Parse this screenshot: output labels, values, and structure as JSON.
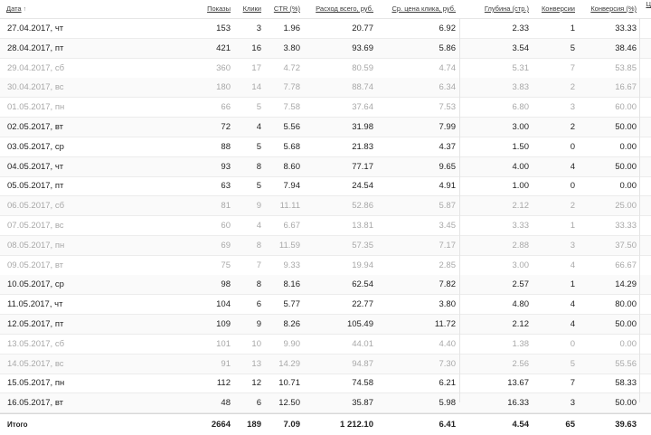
{
  "columns": {
    "date": "Дата",
    "date_sort_icon": "arrow-up",
    "impressions": "Показы",
    "clicks": "Клики",
    "ctr": "CTR (%)",
    "spend": "Расход всего, руб.",
    "cpc": "Ср. цена клика, руб.",
    "depth": "Глубина (стр.)",
    "conversions": "Конверсии",
    "conv_rate": "Конверсия (%)",
    "cut": "Ц"
  },
  "rows": [
    {
      "date": "27.04.2017, чт",
      "impressions": "153",
      "clicks": "3",
      "ctr": "1.96",
      "spend": "20.77",
      "cpc": "6.92",
      "depth": "2.33",
      "conversions": "1",
      "conv_rate": "33.33",
      "muted": false
    },
    {
      "date": "28.04.2017, пт",
      "impressions": "421",
      "clicks": "16",
      "ctr": "3.80",
      "spend": "93.69",
      "cpc": "5.86",
      "depth": "3.54",
      "conversions": "5",
      "conv_rate": "38.46",
      "muted": false
    },
    {
      "date": "29.04.2017, сб",
      "impressions": "360",
      "clicks": "17",
      "ctr": "4.72",
      "spend": "80.59",
      "cpc": "4.74",
      "depth": "5.31",
      "conversions": "7",
      "conv_rate": "53.85",
      "muted": true
    },
    {
      "date": "30.04.2017, вс",
      "impressions": "180",
      "clicks": "14",
      "ctr": "7.78",
      "spend": "88.74",
      "cpc": "6.34",
      "depth": "3.83",
      "conversions": "2",
      "conv_rate": "16.67",
      "muted": true
    },
    {
      "date": "01.05.2017, пн",
      "impressions": "66",
      "clicks": "5",
      "ctr": "7.58",
      "spend": "37.64",
      "cpc": "7.53",
      "depth": "6.80",
      "conversions": "3",
      "conv_rate": "60.00",
      "muted": true
    },
    {
      "date": "02.05.2017, вт",
      "impressions": "72",
      "clicks": "4",
      "ctr": "5.56",
      "spend": "31.98",
      "cpc": "7.99",
      "depth": "3.00",
      "conversions": "2",
      "conv_rate": "50.00",
      "muted": false
    },
    {
      "date": "03.05.2017, ср",
      "impressions": "88",
      "clicks": "5",
      "ctr": "5.68",
      "spend": "21.83",
      "cpc": "4.37",
      "depth": "1.50",
      "conversions": "0",
      "conv_rate": "0.00",
      "muted": false
    },
    {
      "date": "04.05.2017, чт",
      "impressions": "93",
      "clicks": "8",
      "ctr": "8.60",
      "spend": "77.17",
      "cpc": "9.65",
      "depth": "4.00",
      "conversions": "4",
      "conv_rate": "50.00",
      "muted": false
    },
    {
      "date": "05.05.2017, пт",
      "impressions": "63",
      "clicks": "5",
      "ctr": "7.94",
      "spend": "24.54",
      "cpc": "4.91",
      "depth": "1.00",
      "conversions": "0",
      "conv_rate": "0.00",
      "muted": false
    },
    {
      "date": "06.05.2017, сб",
      "impressions": "81",
      "clicks": "9",
      "ctr": "11.11",
      "spend": "52.86",
      "cpc": "5.87",
      "depth": "2.12",
      "conversions": "2",
      "conv_rate": "25.00",
      "muted": true
    },
    {
      "date": "07.05.2017, вс",
      "impressions": "60",
      "clicks": "4",
      "ctr": "6.67",
      "spend": "13.81",
      "cpc": "3.45",
      "depth": "3.33",
      "conversions": "1",
      "conv_rate": "33.33",
      "muted": true
    },
    {
      "date": "08.05.2017, пн",
      "impressions": "69",
      "clicks": "8",
      "ctr": "11.59",
      "spend": "57.35",
      "cpc": "7.17",
      "depth": "2.88",
      "conversions": "3",
      "conv_rate": "37.50",
      "muted": true
    },
    {
      "date": "09.05.2017, вт",
      "impressions": "75",
      "clicks": "7",
      "ctr": "9.33",
      "spend": "19.94",
      "cpc": "2.85",
      "depth": "3.00",
      "conversions": "4",
      "conv_rate": "66.67",
      "muted": true
    },
    {
      "date": "10.05.2017, ср",
      "impressions": "98",
      "clicks": "8",
      "ctr": "8.16",
      "spend": "62.54",
      "cpc": "7.82",
      "depth": "2.57",
      "conversions": "1",
      "conv_rate": "14.29",
      "muted": false
    },
    {
      "date": "11.05.2017, чт",
      "impressions": "104",
      "clicks": "6",
      "ctr": "5.77",
      "spend": "22.77",
      "cpc": "3.80",
      "depth": "4.80",
      "conversions": "4",
      "conv_rate": "80.00",
      "muted": false
    },
    {
      "date": "12.05.2017, пт",
      "impressions": "109",
      "clicks": "9",
      "ctr": "8.26",
      "spend": "105.49",
      "cpc": "11.72",
      "depth": "2.12",
      "conversions": "4",
      "conv_rate": "50.00",
      "muted": false
    },
    {
      "date": "13.05.2017, сб",
      "impressions": "101",
      "clicks": "10",
      "ctr": "9.90",
      "spend": "44.01",
      "cpc": "4.40",
      "depth": "1.38",
      "conversions": "0",
      "conv_rate": "0.00",
      "muted": true
    },
    {
      "date": "14.05.2017, вс",
      "impressions": "91",
      "clicks": "13",
      "ctr": "14.29",
      "spend": "94.87",
      "cpc": "7.30",
      "depth": "2.56",
      "conversions": "5",
      "conv_rate": "55.56",
      "muted": true
    },
    {
      "date": "15.05.2017, пн",
      "impressions": "112",
      "clicks": "12",
      "ctr": "10.71",
      "spend": "74.58",
      "cpc": "6.21",
      "depth": "13.67",
      "conversions": "7",
      "conv_rate": "58.33",
      "muted": false
    },
    {
      "date": "16.05.2017, вт",
      "impressions": "48",
      "clicks": "6",
      "ctr": "12.50",
      "spend": "35.87",
      "cpc": "5.98",
      "depth": "16.33",
      "conversions": "3",
      "conv_rate": "50.00",
      "muted": false
    }
  ],
  "totals": {
    "label": "Итого",
    "impressions": "2664",
    "clicks": "189",
    "ctr": "7.09",
    "spend": "1 212.10",
    "cpc": "6.41",
    "depth": "4.54",
    "conversions": "65",
    "conv_rate": "39.63"
  },
  "colors": {
    "muted_text": "#a8a8a8",
    "text": "#222222",
    "header_text": "#3a3a3a",
    "row_border": "#ececec"
  }
}
